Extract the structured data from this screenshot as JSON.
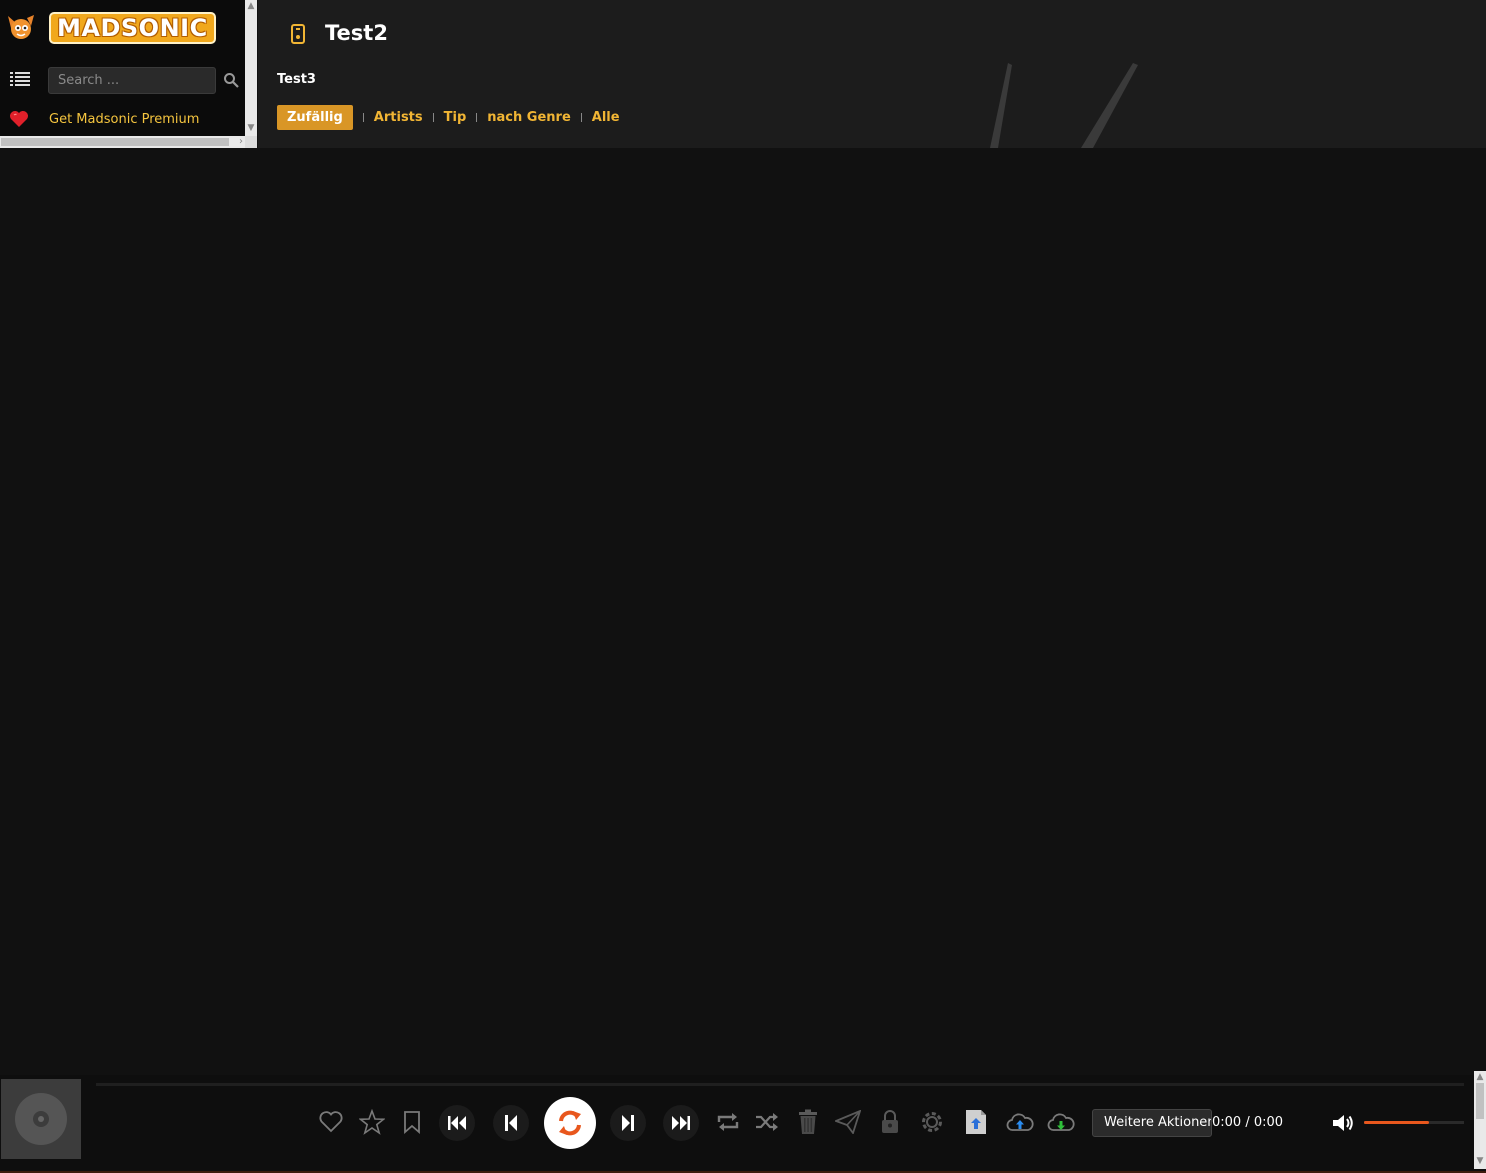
{
  "sidebar": {
    "logo_text": "MADSONIC",
    "search_placeholder": "Search ...",
    "premium_label": "Get Madsonic Premium"
  },
  "header": {
    "title": "Test2",
    "subtitle": "Test3",
    "tabs": [
      {
        "label": "Zufällig",
        "active": true
      },
      {
        "label": "Artists",
        "active": false
      },
      {
        "label": "Tip",
        "active": false
      },
      {
        "label": "nach Genre",
        "active": false
      },
      {
        "label": "Alle",
        "active": false
      }
    ]
  },
  "player": {
    "actions_label": "Weitere Aktionen",
    "time": "0:00 / 0:00",
    "volume_level": 0.65,
    "icons": [
      "heart-icon",
      "star-icon",
      "bookmark-icon",
      "skip-back-icon",
      "previous-icon",
      "refresh-icon",
      "next-icon",
      "skip-forward-icon",
      "repeat-icon",
      "shuffle-icon",
      "trash-icon",
      "send-icon",
      "lock-icon",
      "gear-icon",
      "upload-file-icon",
      "cloud-upload-icon",
      "cloud-download-icon",
      "volume-icon"
    ]
  },
  "colors": {
    "accent": "#f1b534",
    "accent_active_bg": "#d99626",
    "play_icon": "#e8571d",
    "background": "#111111",
    "header_bg": "#1c1c1c"
  }
}
